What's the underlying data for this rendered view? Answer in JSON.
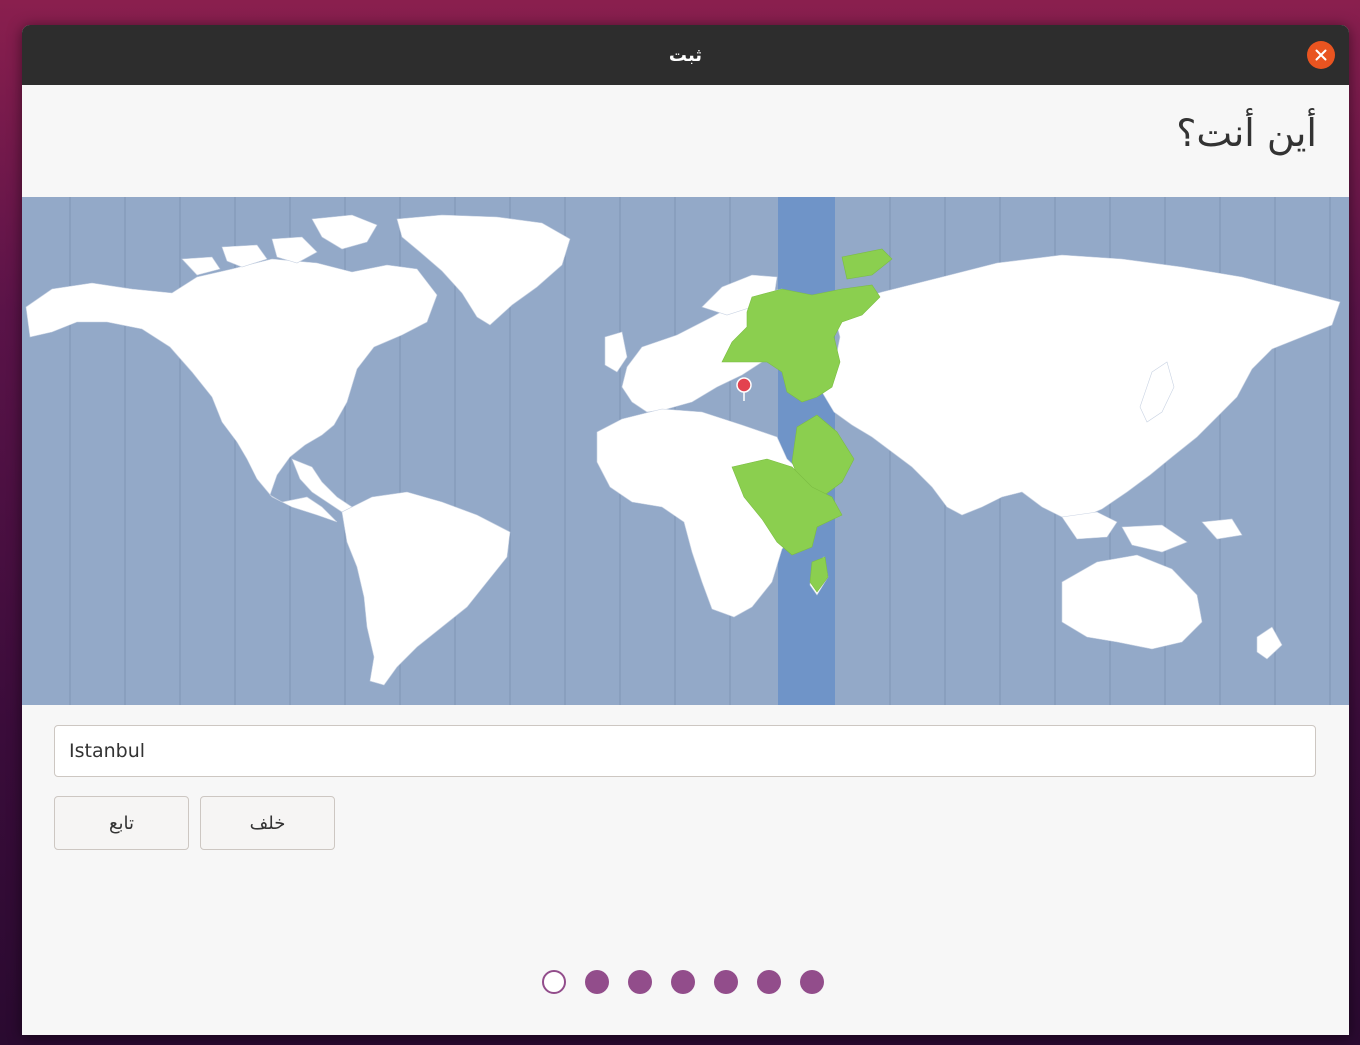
{
  "window": {
    "title": "ثبت"
  },
  "page": {
    "title": "أين أنت؟"
  },
  "timezone_field": {
    "value": "Istanbul"
  },
  "buttons": {
    "continue_label": "تابع",
    "back_label": "خلف"
  },
  "progress": {
    "total_steps": 7,
    "current_step": 1
  },
  "map": {
    "selected_location": "Istanbul",
    "colors": {
      "ocean": "#93a9c8",
      "selected_zone_band": "#6f94c8",
      "land": "#ffffff",
      "highlighted_zone_land": "#8bcf4f",
      "pin": "#e3424f"
    }
  },
  "colors": {
    "accent": "#924d8b",
    "close_button": "#e95420",
    "titlebar": "#2d2d2d"
  },
  "icons": {
    "close": "close-icon",
    "location_pin": "location-pin-icon"
  }
}
